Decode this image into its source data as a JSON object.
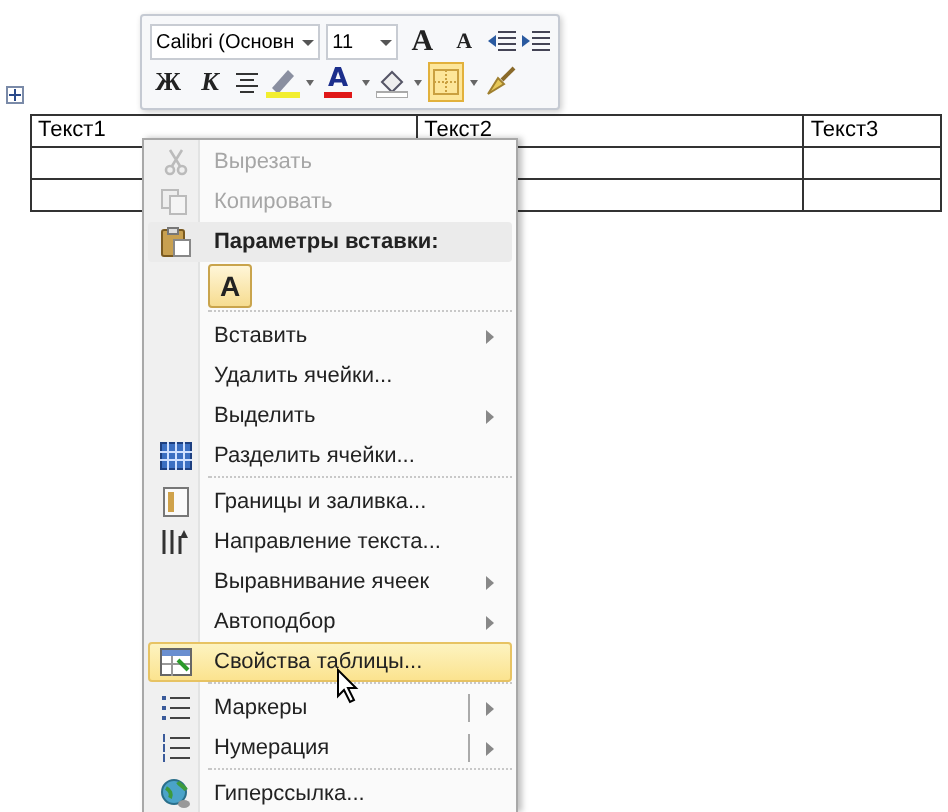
{
  "mini_toolbar": {
    "font": "Calibri (Основн",
    "size": "11",
    "grow_font": "A",
    "shrink_font": "A",
    "bold": "Ж",
    "italic": "К",
    "font_color": "A",
    "borders_selected": true
  },
  "table": {
    "rows": [
      [
        "Текст1",
        "Текст2",
        "Текст3"
      ],
      [
        "",
        "",
        ""
      ],
      [
        "",
        "",
        ""
      ]
    ]
  },
  "context_menu": {
    "items": [
      {
        "kind": "item",
        "label": "Вырезать",
        "disabled": true,
        "submenu": false,
        "selected": false
      },
      {
        "kind": "item",
        "label": "Копировать",
        "disabled": true,
        "submenu": false,
        "selected": false
      },
      {
        "kind": "header",
        "label": "Параметры вставки:"
      },
      {
        "kind": "paste",
        "label": "A"
      },
      {
        "kind": "item",
        "label": "Вставить",
        "disabled": false,
        "submenu": true,
        "selected": false
      },
      {
        "kind": "item",
        "label": "Удалить ячейки...",
        "disabled": false,
        "submenu": false,
        "selected": false
      },
      {
        "kind": "item",
        "label": "Выделить",
        "disabled": false,
        "submenu": true,
        "selected": false
      },
      {
        "kind": "item",
        "label": "Разделить ячейки...",
        "disabled": false,
        "submenu": false,
        "selected": false
      },
      {
        "kind": "separator"
      },
      {
        "kind": "item",
        "label": "Границы и заливка...",
        "disabled": false,
        "submenu": false,
        "selected": false
      },
      {
        "kind": "item",
        "label": "Направление текста...",
        "disabled": false,
        "submenu": false,
        "selected": false
      },
      {
        "kind": "item",
        "label": "Выравнивание ячеек",
        "disabled": false,
        "submenu": true,
        "selected": false
      },
      {
        "kind": "item",
        "label": "Автоподбор",
        "disabled": false,
        "submenu": true,
        "selected": false
      },
      {
        "kind": "item",
        "label": "Свойства таблицы...",
        "disabled": false,
        "submenu": false,
        "selected": true
      },
      {
        "kind": "separator"
      },
      {
        "kind": "split",
        "label": "Маркеры",
        "disabled": false,
        "submenu": true,
        "selected": false
      },
      {
        "kind": "split",
        "label": "Нумерация",
        "disabled": false,
        "submenu": true,
        "selected": false
      },
      {
        "kind": "separator"
      },
      {
        "kind": "item",
        "label": "Гиперссылка...",
        "disabled": false,
        "submenu": false,
        "selected": false
      }
    ]
  }
}
